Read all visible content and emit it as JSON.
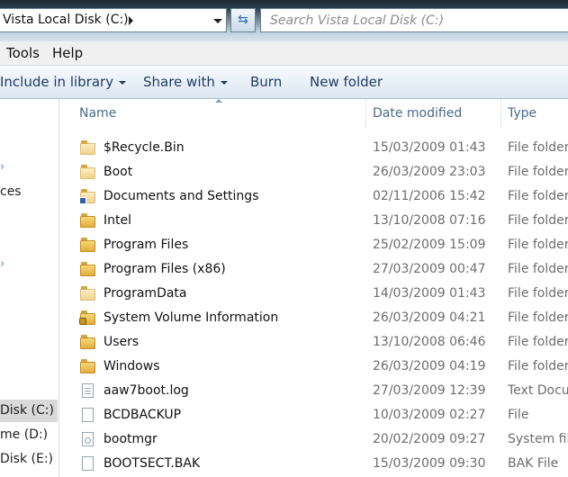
{
  "address": {
    "path": "Vista Local Disk (C:)",
    "search_placeholder": "Search Vista Local Disk (C:)"
  },
  "menu": [
    "Tools",
    "Help"
  ],
  "commands": {
    "include": "Include in library",
    "share": "Share with",
    "burn": "Burn",
    "new_folder": "New folder"
  },
  "nav": {
    "items": [
      "ces",
      "Disk (C:)",
      "me (D:)",
      "Disk (E:)"
    ]
  },
  "columns": {
    "name": "Name",
    "date": "Date modified",
    "type": "Type"
  },
  "files": [
    {
      "name": "$Recycle.Bin",
      "date": "15/03/2009 01:43",
      "type": "File folder",
      "icon": "folder-light-icon"
    },
    {
      "name": "Boot",
      "date": "26/03/2009 23:03",
      "type": "File folder",
      "icon": "folder-light-icon"
    },
    {
      "name": "Documents and Settings",
      "date": "02/11/2006 15:42",
      "type": "File folder",
      "icon": "folder-shortcut-icon"
    },
    {
      "name": "Intel",
      "date": "13/10/2008 07:16",
      "type": "File folder",
      "icon": "folder-icon"
    },
    {
      "name": "Program Files",
      "date": "25/02/2009 15:09",
      "type": "File folder",
      "icon": "folder-icon"
    },
    {
      "name": "Program Files (x86)",
      "date": "27/03/2009 00:47",
      "type": "File folder",
      "icon": "folder-icon"
    },
    {
      "name": "ProgramData",
      "date": "14/03/2009 01:43",
      "type": "File folder",
      "icon": "folder-light-icon"
    },
    {
      "name": "System Volume Information",
      "date": "26/03/2009 04:21",
      "type": "File folder",
      "icon": "folder-locked-icon"
    },
    {
      "name": "Users",
      "date": "13/10/2008 06:46",
      "type": "File folder",
      "icon": "folder-icon"
    },
    {
      "name": "Windows",
      "date": "26/03/2009 04:19",
      "type": "File folder",
      "icon": "folder-icon"
    },
    {
      "name": "aaw7boot.log",
      "date": "27/03/2009 12:39",
      "type": "Text Docu",
      "icon": "text-document-icon"
    },
    {
      "name": "BCDBACKUP",
      "date": "10/03/2009 02:27",
      "type": "File",
      "icon": "file-icon"
    },
    {
      "name": "bootmgr",
      "date": "20/02/2009 09:27",
      "type": "System file",
      "icon": "system-file-icon"
    },
    {
      "name": "BOOTSECT.BAK",
      "date": "15/03/2009 09:30",
      "type": "BAK File",
      "icon": "file-icon"
    }
  ]
}
